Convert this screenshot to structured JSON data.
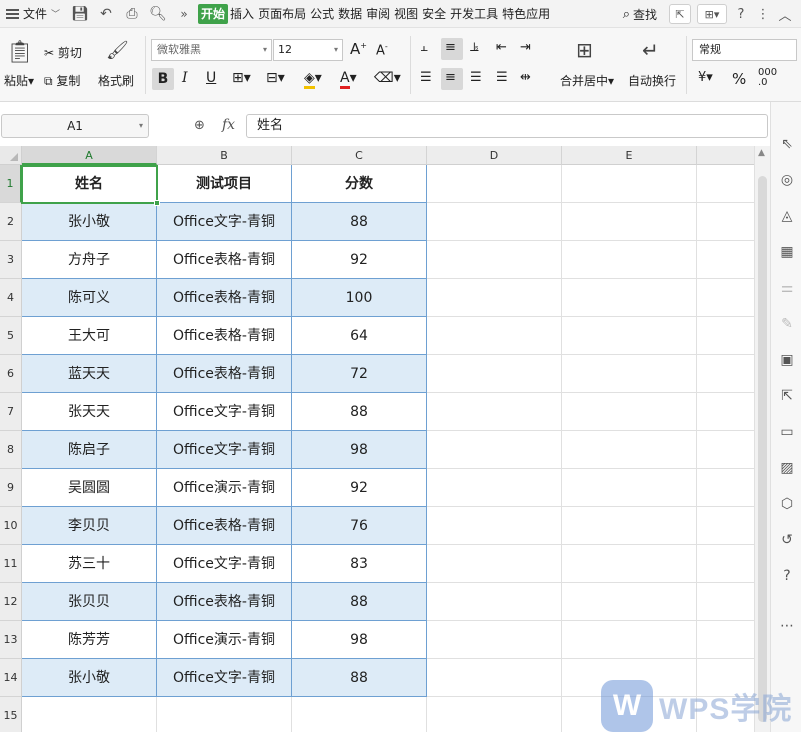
{
  "menubar": {
    "file_label": "文件",
    "tabs": [
      {
        "label": "开始",
        "active": true
      },
      {
        "label": "插入"
      },
      {
        "label": "页面布局"
      },
      {
        "label": "公式"
      },
      {
        "label": "数据"
      },
      {
        "label": "审阅"
      },
      {
        "label": "视图"
      },
      {
        "label": "安全"
      },
      {
        "label": "开发工具"
      },
      {
        "label": "特色应用"
      }
    ],
    "search_label": "查找"
  },
  "ribbon": {
    "paste_label": "粘贴",
    "cut_label": "剪切",
    "copy_label": "复制",
    "format_painter_label": "格式刷",
    "font_name": "微软雅黑",
    "font_size": "12",
    "merge_label": "合并居中",
    "wrap_label": "自动换行",
    "number_format": "常规"
  },
  "formula_bar": {
    "name_box": "A1",
    "fx_label": "fx",
    "content": "姓名"
  },
  "sheet": {
    "columns": [
      "A",
      "B",
      "C",
      "D",
      "E"
    ],
    "row_numbers": [
      "1",
      "2",
      "3",
      "4",
      "5",
      "6",
      "7",
      "8",
      "9",
      "10",
      "11",
      "12",
      "13",
      "14",
      "15"
    ],
    "headers": [
      "姓名",
      "测试项目",
      "分数"
    ],
    "rows": [
      [
        "张小敬",
        "Office文字-青铜",
        "88"
      ],
      [
        "方舟子",
        "Office表格-青铜",
        "92"
      ],
      [
        "陈可义",
        "Office表格-青铜",
        "100"
      ],
      [
        "王大可",
        "Office表格-青铜",
        "64"
      ],
      [
        "蓝天天",
        "Office表格-青铜",
        "72"
      ],
      [
        "张天天",
        "Office文字-青铜",
        "88"
      ],
      [
        "陈启子",
        "Office文字-青铜",
        "98"
      ],
      [
        "吴圆圆",
        "Office演示-青铜",
        "92"
      ],
      [
        "李贝贝",
        "Office表格-青铜",
        "76"
      ],
      [
        "苏三十",
        "Office文字-青铜",
        "83"
      ],
      [
        "张贝贝",
        "Office表格-青铜",
        "88"
      ],
      [
        "陈芳芳",
        "Office演示-青铜",
        "98"
      ],
      [
        "张小敬",
        "Office文字-青铜",
        "88"
      ]
    ],
    "band_color": "#ddebf7",
    "table_border_color": "#6ea0d2",
    "accent_color": "#3fa24a"
  },
  "watermark": {
    "logo_letter": "W",
    "text": "WPS学院"
  }
}
